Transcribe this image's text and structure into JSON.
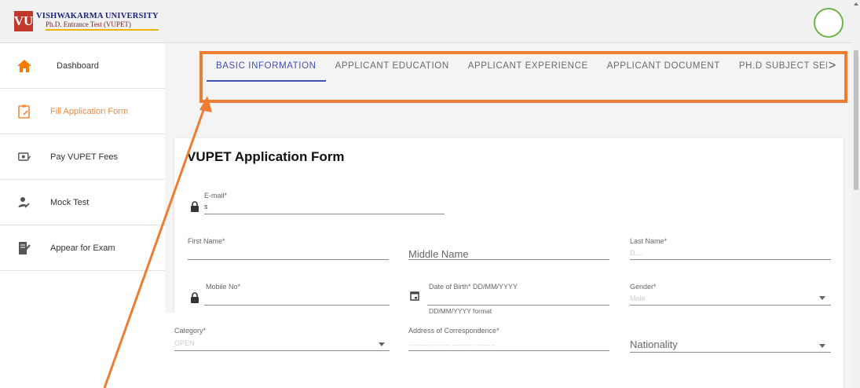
{
  "header": {
    "logo_mark": "VU",
    "title": "VISHWAKARMA UNIVERSITY",
    "subtitle": "Ph.D. Entrance Test (VUPET)"
  },
  "sidebar": {
    "items": [
      {
        "label": "Dashboard",
        "icon": "home-icon"
      },
      {
        "label": "Fill Application Form",
        "icon": "clipboard-edit-icon"
      },
      {
        "label": "Pay VUPET Fees",
        "icon": "payment-icon"
      },
      {
        "label": "Mock Test",
        "icon": "person-edit-icon"
      },
      {
        "label": "Appear for Exam",
        "icon": "exam-icon"
      }
    ]
  },
  "tabs": [
    {
      "label": "BASIC INFORMATION"
    },
    {
      "label": "APPLICANT EDUCATION"
    },
    {
      "label": "APPLICANT EXPERIENCE"
    },
    {
      "label": "APPLICANT DOCUMENT"
    },
    {
      "label": "PH.D SUBJECT SELECTION"
    }
  ],
  "tab_arrow": ">",
  "form": {
    "title": "VUPET Application Form",
    "email_label": "E-mail*",
    "email_value": "s",
    "first_name_label": "First Name*",
    "middle_name_placeholder": "Middle Name",
    "last_name_label": "Last Name*",
    "last_name_value": "D....",
    "mobile_label": "Mobile No*",
    "dob_label": "Date of Birth* DD/MM/YYYY",
    "dob_hint": "DD/MM/YYYY format",
    "gender_label": "Gender*",
    "gender_value": "Male",
    "category_label": "Category*",
    "category_value": "OPEN",
    "address_label": "Address of Correspondence*",
    "address_value": "..........,........., ........., ..........,",
    "nationality_placeholder": "Nationality"
  },
  "colors": {
    "accent": "#3f51b5",
    "active_sidebar": "#f5893b",
    "annotation": "#ed7d31",
    "brand_red": "#c0392b"
  }
}
